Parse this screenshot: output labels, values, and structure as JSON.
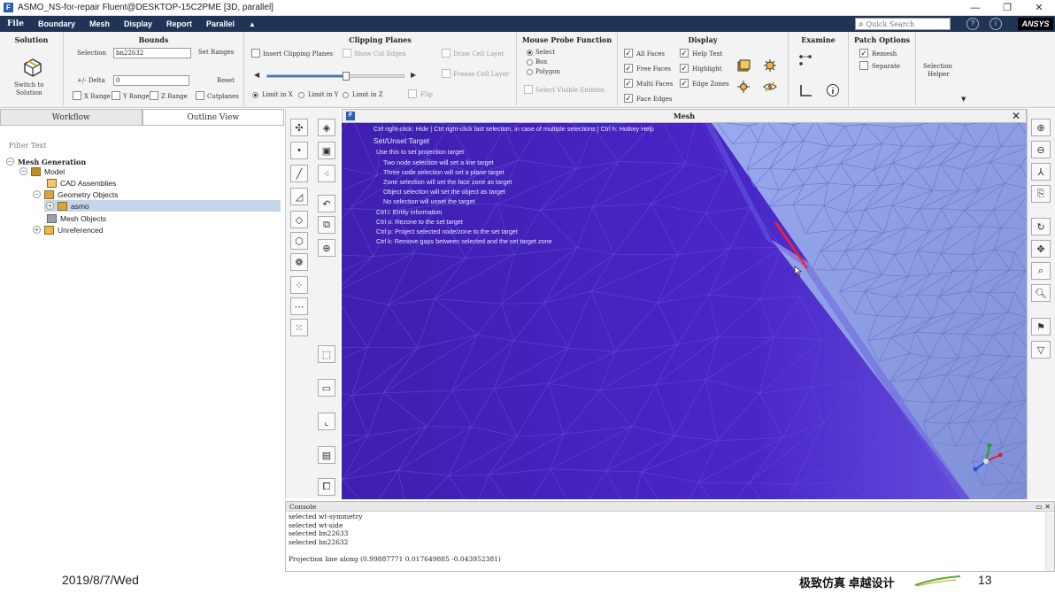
{
  "window": {
    "title": "ASMO_NS-for-repair Fluent@DESKTOP-15C2PME  [3D, parallel]",
    "app_icon": "F"
  },
  "menubar": {
    "items": [
      "File",
      "Boundary",
      "Mesh",
      "Display",
      "Report",
      "Parallel",
      "▲"
    ],
    "search_placeholder": "Quick Search",
    "brand": "ANSYS"
  },
  "ribbon": {
    "solution": {
      "title": "Solution",
      "switch_label_1": "Switch to",
      "switch_label_2": "Solution"
    },
    "bounds": {
      "title": "Bounds",
      "selection_label": "Selection",
      "selection_value": "bn22632",
      "set_ranges": "Set Ranges",
      "delta_label": "+/- Delta",
      "delta_value": "0",
      "reset": "Reset",
      "x_range": "X Range",
      "y_range": "Y Range",
      "z_range": "Z Range",
      "cutplanes": "Cutplanes"
    },
    "clipping": {
      "title": "Clipping Planes",
      "insert": "Insert Clipping Planes",
      "show_cut_edges": "Show Cut Edges",
      "draw_cell_layer": "Draw Cell Layer",
      "freeze_cell_layer": "Freeze Cell Layer",
      "limit_x": "Limit in X",
      "limit_y": "Limit in Y",
      "limit_z": "Limit in Z",
      "flip": "Flip",
      "slider_value": 0.58
    },
    "probe": {
      "title": "Mouse Probe Function",
      "select": "Select",
      "box": "Box",
      "polygon": "Polygon",
      "select_visible": "Select Visible Entities"
    },
    "display": {
      "title": "Display",
      "all_faces": "All Faces",
      "free_faces": "Free Faces",
      "multi_faces": "Multi Faces",
      "face_edges": "Face Edges",
      "help_text": "Help Text",
      "highlight": "Highlight",
      "edge_zones": "Edge Zones"
    },
    "examine": {
      "title": "Examine"
    },
    "patch": {
      "title": "Patch Options",
      "remesh": "Remesh",
      "separate": "Separate"
    },
    "selection_helper": {
      "line1": "Selection",
      "line2": "Helper"
    }
  },
  "left_panel": {
    "tabs": [
      "Workflow",
      "Outline View"
    ],
    "active_tab": "Outline View",
    "filter_placeholder": "Filter Text",
    "tree": {
      "root": "Mesh Generation",
      "model": "Model",
      "cad": "CAD Assemblies",
      "geometry": "Geometry Objects",
      "asmo": "asmo",
      "mesh_objects": "Mesh Objects",
      "unreferenced": "Unreferenced"
    }
  },
  "mesh_window": {
    "title": "Mesh",
    "hint_line1": "Ctrl right-click: Hide | Ctrl right-click last selection, in case of multiple selections | Ctrl h: Hotkey Help",
    "hint_heading": "Set/Unset Target",
    "hint_lines": [
      "Use this to set projection target",
      "Two node selection will set a line target",
      "Three node selection will set a plane target",
      "Zone selection will set the face zone as target",
      "Object selection will set the object as target",
      "No selection will unset the target",
      "Ctrl i: Entity information",
      "Ctrl o: Rezone to the set target",
      "Ctrl p: Project selected node/zone to the set target",
      "Ctrl k: Remove gaps between selected and the set target zone"
    ]
  },
  "console": {
    "title": "Console",
    "lines": [
      "selected wt-symmetry",
      "selected wt-side",
      "selected bn22633",
      "selected bn22632",
      "",
      "Projection line along (0.99887771 0.017649885 -0.043952381)"
    ]
  },
  "footer": {
    "date": "2019/8/7/Wed",
    "slogan": "极致仿真 卓越设计",
    "page": "13"
  },
  "colors": {
    "menubar": "#1e3556",
    "mesh_dark": "#4a22c8",
    "mesh_light": "#8a9ae0",
    "selected_edge": "#ff2020",
    "hint_text": "#e8e8ff"
  }
}
